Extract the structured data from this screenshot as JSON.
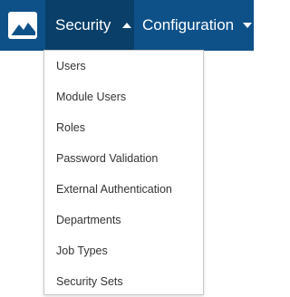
{
  "header": {
    "logo_icon": "mountain-logo-icon",
    "colors": {
      "bar": "#0e5189",
      "active_tab": "#093f68",
      "text": "#ffffff"
    },
    "nav": [
      {
        "label": "Security",
        "state": "open",
        "caret": "caret-up-icon"
      },
      {
        "label": "Configuration",
        "state": "closed",
        "caret": "caret-down-icon"
      }
    ]
  },
  "security_menu": {
    "items": [
      {
        "label": "Users"
      },
      {
        "label": "Module Users"
      },
      {
        "label": "Roles"
      },
      {
        "label": "Password Validation"
      },
      {
        "label": "External Authentication"
      },
      {
        "label": "Departments"
      },
      {
        "label": "Job Types"
      },
      {
        "label": "Security Sets"
      }
    ]
  }
}
